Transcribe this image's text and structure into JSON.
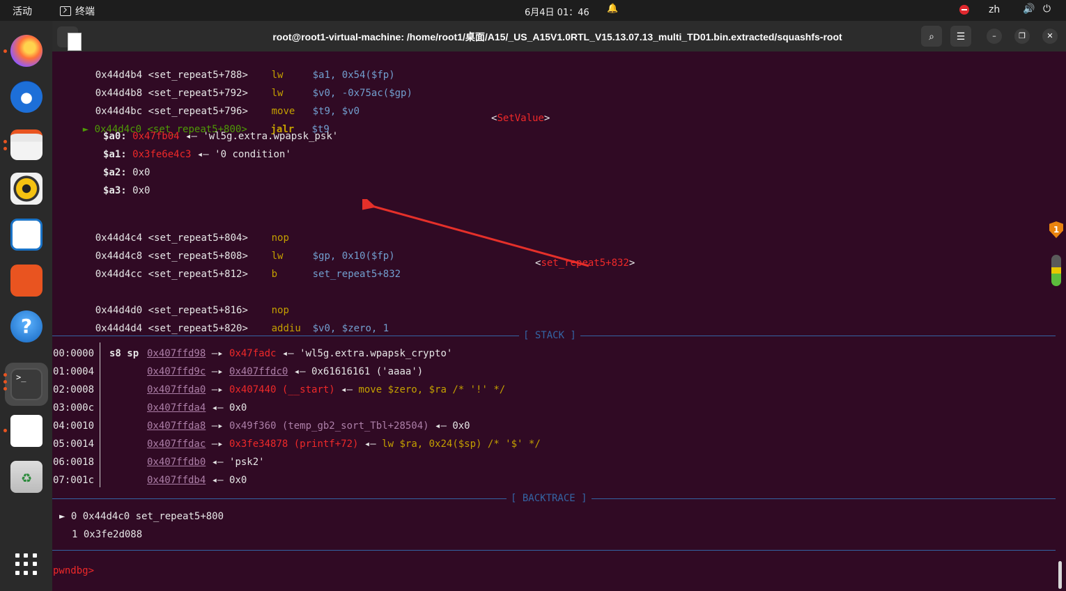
{
  "topbar": {
    "activities": "活动",
    "app_name": "终端",
    "clock": "6月4日 01：46",
    "lang": "zh"
  },
  "window": {
    "title": "root@root1-virtual-machine: /home/root1/桌面/A15/_US_A15V1.0RTL_V15.13.07.13_multi_TD01.bin.extracted/squashfs-root"
  },
  "disasm": [
    {
      "addr": "0x44d4b4",
      "sym": "<set_repeat5+788>",
      "op": "lw",
      "args": "$a1, 0x54($fp)"
    },
    {
      "addr": "0x44d4b8",
      "sym": "<set_repeat5+792>",
      "op": "lw",
      "args": "$v0, -0x75ac($gp)"
    },
    {
      "addr": "0x44d4bc",
      "sym": "<set_repeat5+796>",
      "op": "move",
      "args": "$t9, $v0"
    },
    {
      "addr": "0x44d4c0",
      "sym": "<set_repeat5+800>",
      "op": "jalr",
      "args": "$t9",
      "target": "SetValue"
    },
    {
      "addr": "0x44d4c4",
      "sym": "<set_repeat5+804>",
      "op": "nop",
      "args": ""
    },
    {
      "addr": "0x44d4c8",
      "sym": "<set_repeat5+808>",
      "op": "lw",
      "args": "$gp, 0x10($fp)"
    },
    {
      "addr": "0x44d4cc",
      "sym": "<set_repeat5+812>",
      "op": "b",
      "args": "set_repeat5+832",
      "target": "set_repeat5+832"
    },
    {
      "addr": "0x44d4d0",
      "sym": "<set_repeat5+816>",
      "op": "nop",
      "args": ""
    },
    {
      "addr": "0x44d4d4",
      "sym": "<set_repeat5+820>",
      "op": "addiu",
      "args": "$v0, $zero, 1"
    }
  ],
  "call_args": [
    {
      "reg": "$a0:",
      "ptr": "0x47fb04",
      "val": "'wl5g.extra.wpapsk_psk'"
    },
    {
      "reg": "$a1:",
      "ptr": "0x3fe6e4c3",
      "val": "'0 condition'"
    },
    {
      "reg": "$a2:",
      "ptr": "",
      "val": "0x0"
    },
    {
      "reg": "$a3:",
      "ptr": "",
      "val": "0x0"
    }
  ],
  "stack_label": "[ STACK ]",
  "stack": [
    {
      "off": "00:0000",
      "regs": "s8 sp",
      "addr": "0x407ffd98",
      "t1": "0x47fadc",
      "rest": "'wl5g.extra.wpapsk_crypto'"
    },
    {
      "off": "01:0004",
      "regs": "",
      "addr": "0x407ffd9c",
      "t1": "0x407ffdc0",
      "rest": "0x61616161 ('aaaa')"
    },
    {
      "off": "02:0008",
      "regs": "",
      "addr": "0x407ffda0",
      "t1": "0x407440 (__start)",
      "rest": "move $zero, $ra /* '!' */"
    },
    {
      "off": "03:000c",
      "regs": "",
      "addr": "0x407ffda4",
      "t1": "",
      "rest": "0x0"
    },
    {
      "off": "04:0010",
      "regs": "",
      "addr": "0x407ffda8",
      "t1": "0x49f360 (temp_gb2_sort_Tbl+28504)",
      "rest": "0x0"
    },
    {
      "off": "05:0014",
      "regs": "",
      "addr": "0x407ffdac",
      "t1": "0x3fe34878 (printf+72)",
      "rest": "lw $ra, 0x24($sp) /* '$' */"
    },
    {
      "off": "06:0018",
      "regs": "",
      "addr": "0x407ffdb0",
      "t1": "",
      "rest": "'psk2'"
    },
    {
      "off": "07:001c",
      "regs": "",
      "addr": "0x407ffdb4",
      "t1": "",
      "rest": "0x0"
    }
  ],
  "backtrace_label": "[ BACKTRACE ]",
  "backtrace": [
    {
      "idx": "0",
      "text": "0x44d4c0 set_repeat5+800"
    },
    {
      "idx": "1",
      "text": "0x3fe2d088"
    }
  ],
  "prompt": "pwndbg>",
  "tray_badge": "1"
}
